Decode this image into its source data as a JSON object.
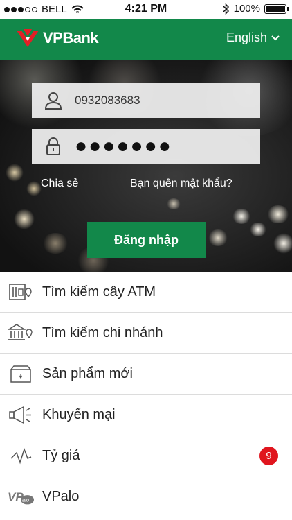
{
  "status_bar": {
    "carrier": "BELL",
    "time": "4:21 PM",
    "battery": "100%",
    "battery_level": 1.0
  },
  "header": {
    "brand": "VPBank",
    "language": "English"
  },
  "login": {
    "username_value": "0932083683",
    "password_value": "●●●●●●●",
    "share_label": "Chia sẻ",
    "forgot_label": "Bạn quên mật khẩu?",
    "login_button": "Đăng nhập"
  },
  "menu": [
    {
      "label": "Tìm kiếm cây ATM",
      "icon": "atm-icon"
    },
    {
      "label": "Tìm kiếm chi nhánh",
      "icon": "bank-branch-icon"
    },
    {
      "label": "Sản phẩm mới",
      "icon": "new-product-box-icon"
    },
    {
      "label": "Khuyến mại",
      "icon": "megaphone-icon"
    },
    {
      "label": "Tỷ giá",
      "icon": "exchange-rate-chart-icon",
      "badge": "9"
    },
    {
      "label": "VPalo",
      "icon": "vpalo-logo-icon"
    }
  ],
  "colors": {
    "brand_green": "#12884a",
    "badge_red": "#e0151e",
    "logo_red": "#e31f26"
  }
}
